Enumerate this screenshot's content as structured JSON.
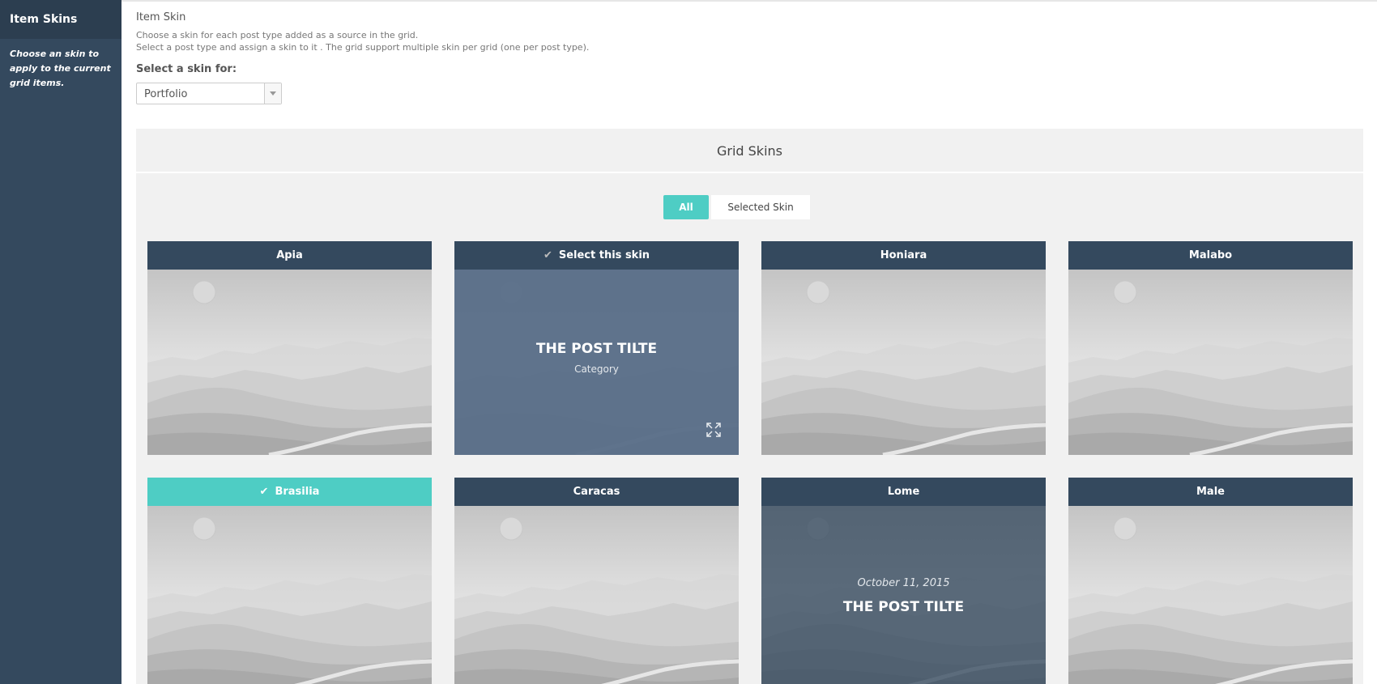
{
  "sidebar": {
    "title": "Item Skins",
    "description": "Choose an skin to apply to the current grid items."
  },
  "section": {
    "title": "Item Skin",
    "description_line1": "Choose a skin for each post type added as a source in the grid.",
    "description_line2": "Select a post type and assign a skin to it . The grid support multiple skin per grid (one per post type)."
  },
  "skin_select": {
    "label": "Select a skin for:",
    "value": "Portfolio"
  },
  "panel": {
    "title": "Grid Skins",
    "filters": {
      "all": "All",
      "selected": "Selected Skin"
    }
  },
  "cards": [
    {
      "name": "Apia"
    },
    {
      "name": "Select this skin",
      "overlay_title": "THE POST TILTE",
      "overlay_category": "Category"
    },
    {
      "name": "Honiara"
    },
    {
      "name": "Malabo"
    },
    {
      "name": "Brasilia",
      "selected": true
    },
    {
      "name": "Caracas"
    },
    {
      "name": "Lome",
      "overlay_date": "October 11, 2015",
      "overlay_title": "THE POST TILTE"
    },
    {
      "name": "Male"
    }
  ],
  "colors": {
    "sidebar": "#34495e",
    "card_header": "#34495e",
    "accent": "#4ecdc4",
    "panel_bg": "#f1f1f1"
  },
  "icons": {
    "check": "check-icon",
    "expand": "expand-icon",
    "select_arrow": "chevron-down-icon"
  }
}
